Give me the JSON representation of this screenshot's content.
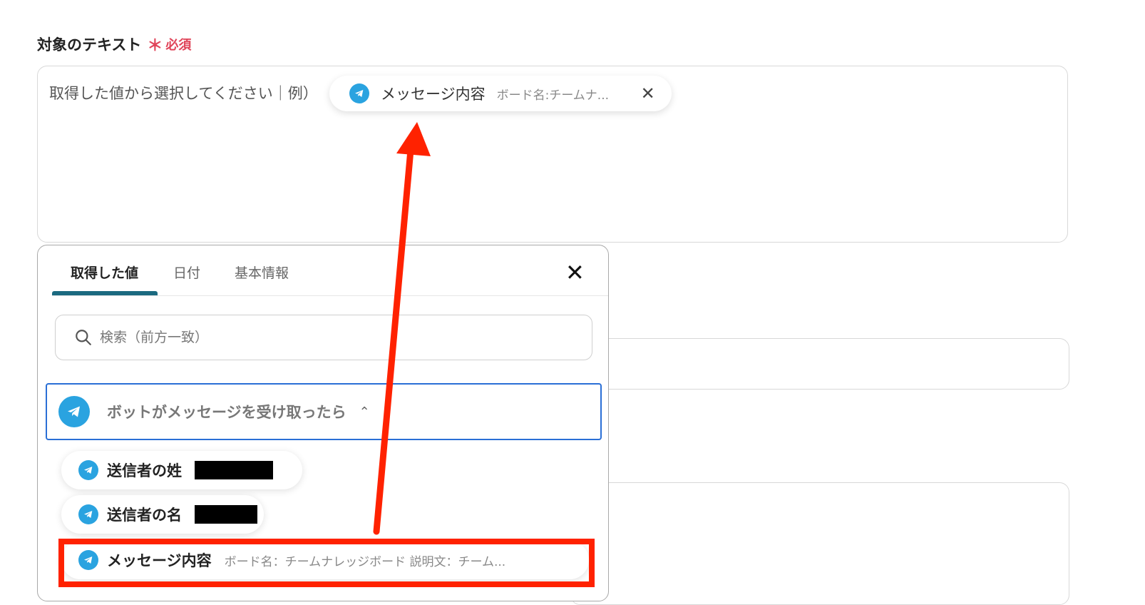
{
  "field": {
    "label": "対象のテキスト",
    "required_star": "＊",
    "required_text": "必須",
    "placeholder": "取得した値から選択してください｜例）"
  },
  "token": {
    "title": "メッセージ内容",
    "subtitle": "ボード名:チームナ...",
    "close": "✕",
    "icon": "telegram-icon"
  },
  "popup": {
    "tabs": [
      {
        "label": "取得した値",
        "active": true
      },
      {
        "label": "日付",
        "active": false
      },
      {
        "label": "基本情報",
        "active": false
      }
    ],
    "close": "✕",
    "search_placeholder": "検索（前方一致）",
    "group": {
      "title": "ボットがメッセージを受け取ったら",
      "chevron": "⌃",
      "icon": "telegram-icon"
    },
    "items": [
      {
        "title": "送信者の姓",
        "value": "",
        "redacted": true
      },
      {
        "title": "送信者の名",
        "value": "",
        "redacted": true
      },
      {
        "title": "メッセージ内容",
        "value": "ボード名：チームナレッジボード 説明文：チーム..."
      }
    ]
  },
  "colors": {
    "accent": "#1b6a80",
    "required": "#e0455a",
    "telegram": "#2aa3e0",
    "selection_border": "#2a6fd6",
    "annotation": "#ff2200"
  }
}
